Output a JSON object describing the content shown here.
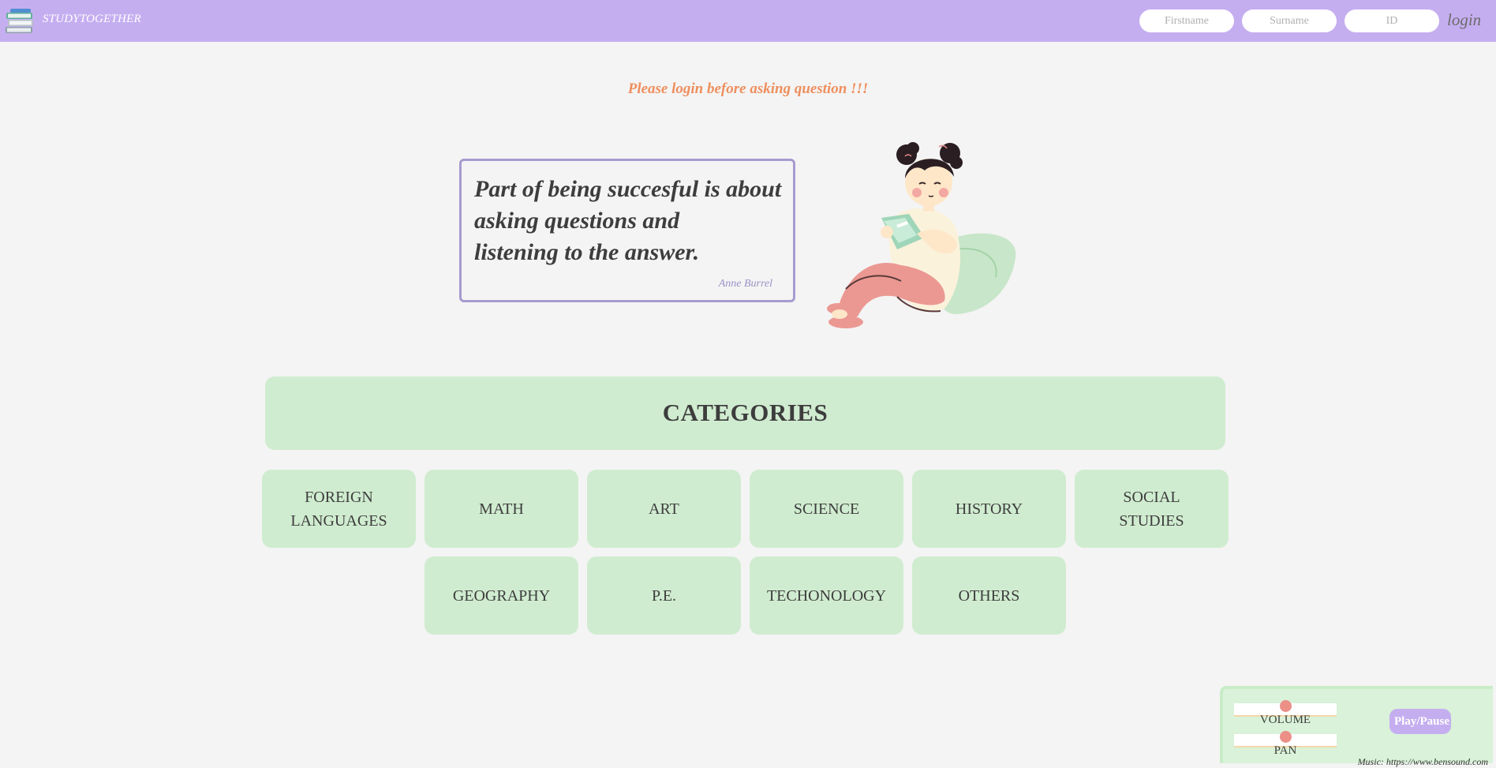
{
  "header": {
    "logo_icon": "book-stack-icon",
    "brand": "STUDYTOGETHER",
    "firstname_placeholder": "Firstname",
    "surname_placeholder": "Surname",
    "id_placeholder": "ID",
    "login_label": "login",
    "bg_color": "#c5aef0"
  },
  "notice": "Please login before asking question !!!",
  "quote": {
    "line1": "Part of being succesful is about",
    "line2": "asking questions and",
    "line3": "listening to the answer.",
    "author": "Anne Burrel"
  },
  "illustration_icon": "girl-reading-book-illustration",
  "categories": {
    "title": "CATEGORIES",
    "items": [
      {
        "label": "FOREIGN LANGUAGES"
      },
      {
        "label": "MATH"
      },
      {
        "label": "ART"
      },
      {
        "label": "SCIENCE"
      },
      {
        "label": "HISTORY"
      },
      {
        "label": "SOCIAL STUDIES"
      },
      {
        "label": "GEOGRAPHY"
      },
      {
        "label": "P.E."
      },
      {
        "label": "TECHONOLOGY"
      },
      {
        "label": "OTHERS"
      }
    ]
  },
  "player": {
    "volume_label": "VOLUME",
    "pan_label": "PAN",
    "volume_level": 0.5,
    "pan_level": 0.5,
    "play_label": "Play/Pause",
    "credit": "Music: https://www.bensound.com"
  },
  "colors": {
    "accent": "#c5aef0",
    "category_bg": "#d0ecd0",
    "notice": "#ee8f5e"
  }
}
